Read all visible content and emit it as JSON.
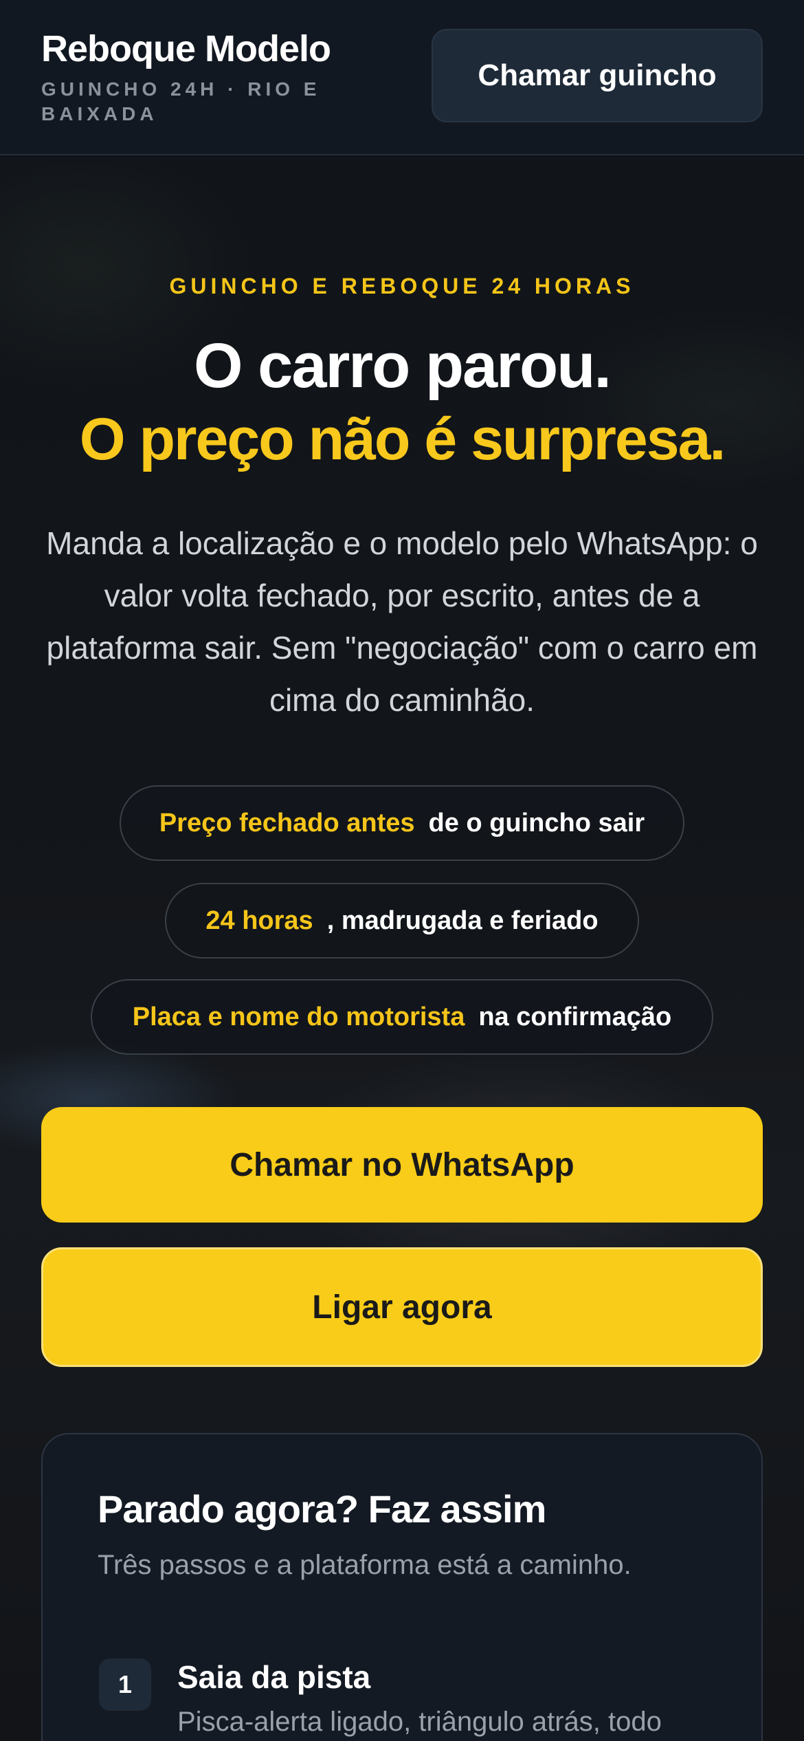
{
  "header": {
    "brand": "Reboque Modelo",
    "tagline": "Guincho 24h · Rio e Baixada",
    "call_button": "Chamar guincho"
  },
  "hero": {
    "eyebrow": "GUINCHO E REBOQUE 24 HORAS",
    "headline_line1": "O carro parou.",
    "headline_line2": "O preço não é surpresa.",
    "lede": "Manda a localização e o modelo pelo WhatsApp: o valor volta fechado, por escrito, antes de a plataforma sair. Sem \"negociação\" com o carro em cima do caminhão.",
    "pills": [
      {
        "highlight": "Preço fechado antes",
        "text": "de o guincho sair"
      },
      {
        "highlight": "24 horas",
        "text": ", madrugada e feriado"
      },
      {
        "highlight": "Placa e nome do motorista",
        "text": "na confirmação"
      }
    ],
    "cta_whatsapp": "Chamar no WhatsApp",
    "cta_call": "Ligar agora"
  },
  "steps_card": {
    "title": "Parado agora? Faz assim",
    "subtitle": "Três passos e a plataforma está a caminho.",
    "steps": [
      {
        "number": "1",
        "title": "Saia da pista",
        "desc": "Pisca-alerta ligado, triângulo atrás, todo"
      }
    ]
  },
  "colors": {
    "accent": "#f8cc18",
    "background": "#0d1117",
    "header": "#121821"
  }
}
